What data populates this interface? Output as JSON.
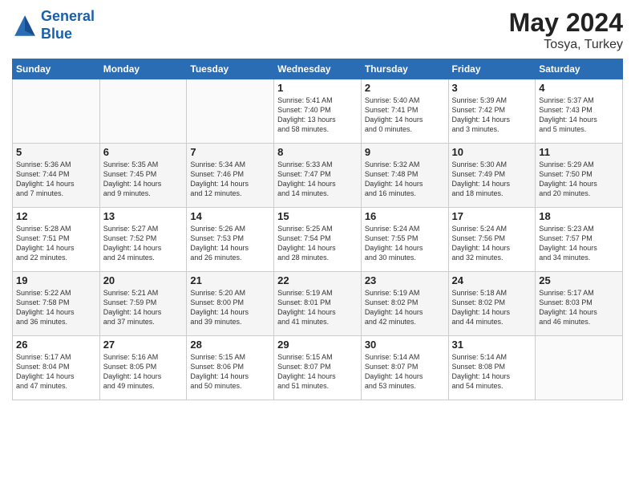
{
  "header": {
    "logo_line1": "General",
    "logo_line2": "Blue",
    "month_year": "May 2024",
    "location": "Tosya, Turkey"
  },
  "weekdays": [
    "Sunday",
    "Monday",
    "Tuesday",
    "Wednesday",
    "Thursday",
    "Friday",
    "Saturday"
  ],
  "weeks": [
    [
      {
        "day": "",
        "info": "",
        "empty": true
      },
      {
        "day": "",
        "info": "",
        "empty": true
      },
      {
        "day": "",
        "info": "",
        "empty": true
      },
      {
        "day": "1",
        "info": "Sunrise: 5:41 AM\nSunset: 7:40 PM\nDaylight: 13 hours\nand 58 minutes.",
        "empty": false
      },
      {
        "day": "2",
        "info": "Sunrise: 5:40 AM\nSunset: 7:41 PM\nDaylight: 14 hours\nand 0 minutes.",
        "empty": false
      },
      {
        "day": "3",
        "info": "Sunrise: 5:39 AM\nSunset: 7:42 PM\nDaylight: 14 hours\nand 3 minutes.",
        "empty": false
      },
      {
        "day": "4",
        "info": "Sunrise: 5:37 AM\nSunset: 7:43 PM\nDaylight: 14 hours\nand 5 minutes.",
        "empty": false
      }
    ],
    [
      {
        "day": "5",
        "info": "Sunrise: 5:36 AM\nSunset: 7:44 PM\nDaylight: 14 hours\nand 7 minutes.",
        "empty": false
      },
      {
        "day": "6",
        "info": "Sunrise: 5:35 AM\nSunset: 7:45 PM\nDaylight: 14 hours\nand 9 minutes.",
        "empty": false
      },
      {
        "day": "7",
        "info": "Sunrise: 5:34 AM\nSunset: 7:46 PM\nDaylight: 14 hours\nand 12 minutes.",
        "empty": false
      },
      {
        "day": "8",
        "info": "Sunrise: 5:33 AM\nSunset: 7:47 PM\nDaylight: 14 hours\nand 14 minutes.",
        "empty": false
      },
      {
        "day": "9",
        "info": "Sunrise: 5:32 AM\nSunset: 7:48 PM\nDaylight: 14 hours\nand 16 minutes.",
        "empty": false
      },
      {
        "day": "10",
        "info": "Sunrise: 5:30 AM\nSunset: 7:49 PM\nDaylight: 14 hours\nand 18 minutes.",
        "empty": false
      },
      {
        "day": "11",
        "info": "Sunrise: 5:29 AM\nSunset: 7:50 PM\nDaylight: 14 hours\nand 20 minutes.",
        "empty": false
      }
    ],
    [
      {
        "day": "12",
        "info": "Sunrise: 5:28 AM\nSunset: 7:51 PM\nDaylight: 14 hours\nand 22 minutes.",
        "empty": false
      },
      {
        "day": "13",
        "info": "Sunrise: 5:27 AM\nSunset: 7:52 PM\nDaylight: 14 hours\nand 24 minutes.",
        "empty": false
      },
      {
        "day": "14",
        "info": "Sunrise: 5:26 AM\nSunset: 7:53 PM\nDaylight: 14 hours\nand 26 minutes.",
        "empty": false
      },
      {
        "day": "15",
        "info": "Sunrise: 5:25 AM\nSunset: 7:54 PM\nDaylight: 14 hours\nand 28 minutes.",
        "empty": false
      },
      {
        "day": "16",
        "info": "Sunrise: 5:24 AM\nSunset: 7:55 PM\nDaylight: 14 hours\nand 30 minutes.",
        "empty": false
      },
      {
        "day": "17",
        "info": "Sunrise: 5:24 AM\nSunset: 7:56 PM\nDaylight: 14 hours\nand 32 minutes.",
        "empty": false
      },
      {
        "day": "18",
        "info": "Sunrise: 5:23 AM\nSunset: 7:57 PM\nDaylight: 14 hours\nand 34 minutes.",
        "empty": false
      }
    ],
    [
      {
        "day": "19",
        "info": "Sunrise: 5:22 AM\nSunset: 7:58 PM\nDaylight: 14 hours\nand 36 minutes.",
        "empty": false
      },
      {
        "day": "20",
        "info": "Sunrise: 5:21 AM\nSunset: 7:59 PM\nDaylight: 14 hours\nand 37 minutes.",
        "empty": false
      },
      {
        "day": "21",
        "info": "Sunrise: 5:20 AM\nSunset: 8:00 PM\nDaylight: 14 hours\nand 39 minutes.",
        "empty": false
      },
      {
        "day": "22",
        "info": "Sunrise: 5:19 AM\nSunset: 8:01 PM\nDaylight: 14 hours\nand 41 minutes.",
        "empty": false
      },
      {
        "day": "23",
        "info": "Sunrise: 5:19 AM\nSunset: 8:02 PM\nDaylight: 14 hours\nand 42 minutes.",
        "empty": false
      },
      {
        "day": "24",
        "info": "Sunrise: 5:18 AM\nSunset: 8:02 PM\nDaylight: 14 hours\nand 44 minutes.",
        "empty": false
      },
      {
        "day": "25",
        "info": "Sunrise: 5:17 AM\nSunset: 8:03 PM\nDaylight: 14 hours\nand 46 minutes.",
        "empty": false
      }
    ],
    [
      {
        "day": "26",
        "info": "Sunrise: 5:17 AM\nSunset: 8:04 PM\nDaylight: 14 hours\nand 47 minutes.",
        "empty": false
      },
      {
        "day": "27",
        "info": "Sunrise: 5:16 AM\nSunset: 8:05 PM\nDaylight: 14 hours\nand 49 minutes.",
        "empty": false
      },
      {
        "day": "28",
        "info": "Sunrise: 5:15 AM\nSunset: 8:06 PM\nDaylight: 14 hours\nand 50 minutes.",
        "empty": false
      },
      {
        "day": "29",
        "info": "Sunrise: 5:15 AM\nSunset: 8:07 PM\nDaylight: 14 hours\nand 51 minutes.",
        "empty": false
      },
      {
        "day": "30",
        "info": "Sunrise: 5:14 AM\nSunset: 8:07 PM\nDaylight: 14 hours\nand 53 minutes.",
        "empty": false
      },
      {
        "day": "31",
        "info": "Sunrise: 5:14 AM\nSunset: 8:08 PM\nDaylight: 14 hours\nand 54 minutes.",
        "empty": false
      },
      {
        "day": "",
        "info": "",
        "empty": true
      }
    ]
  ]
}
